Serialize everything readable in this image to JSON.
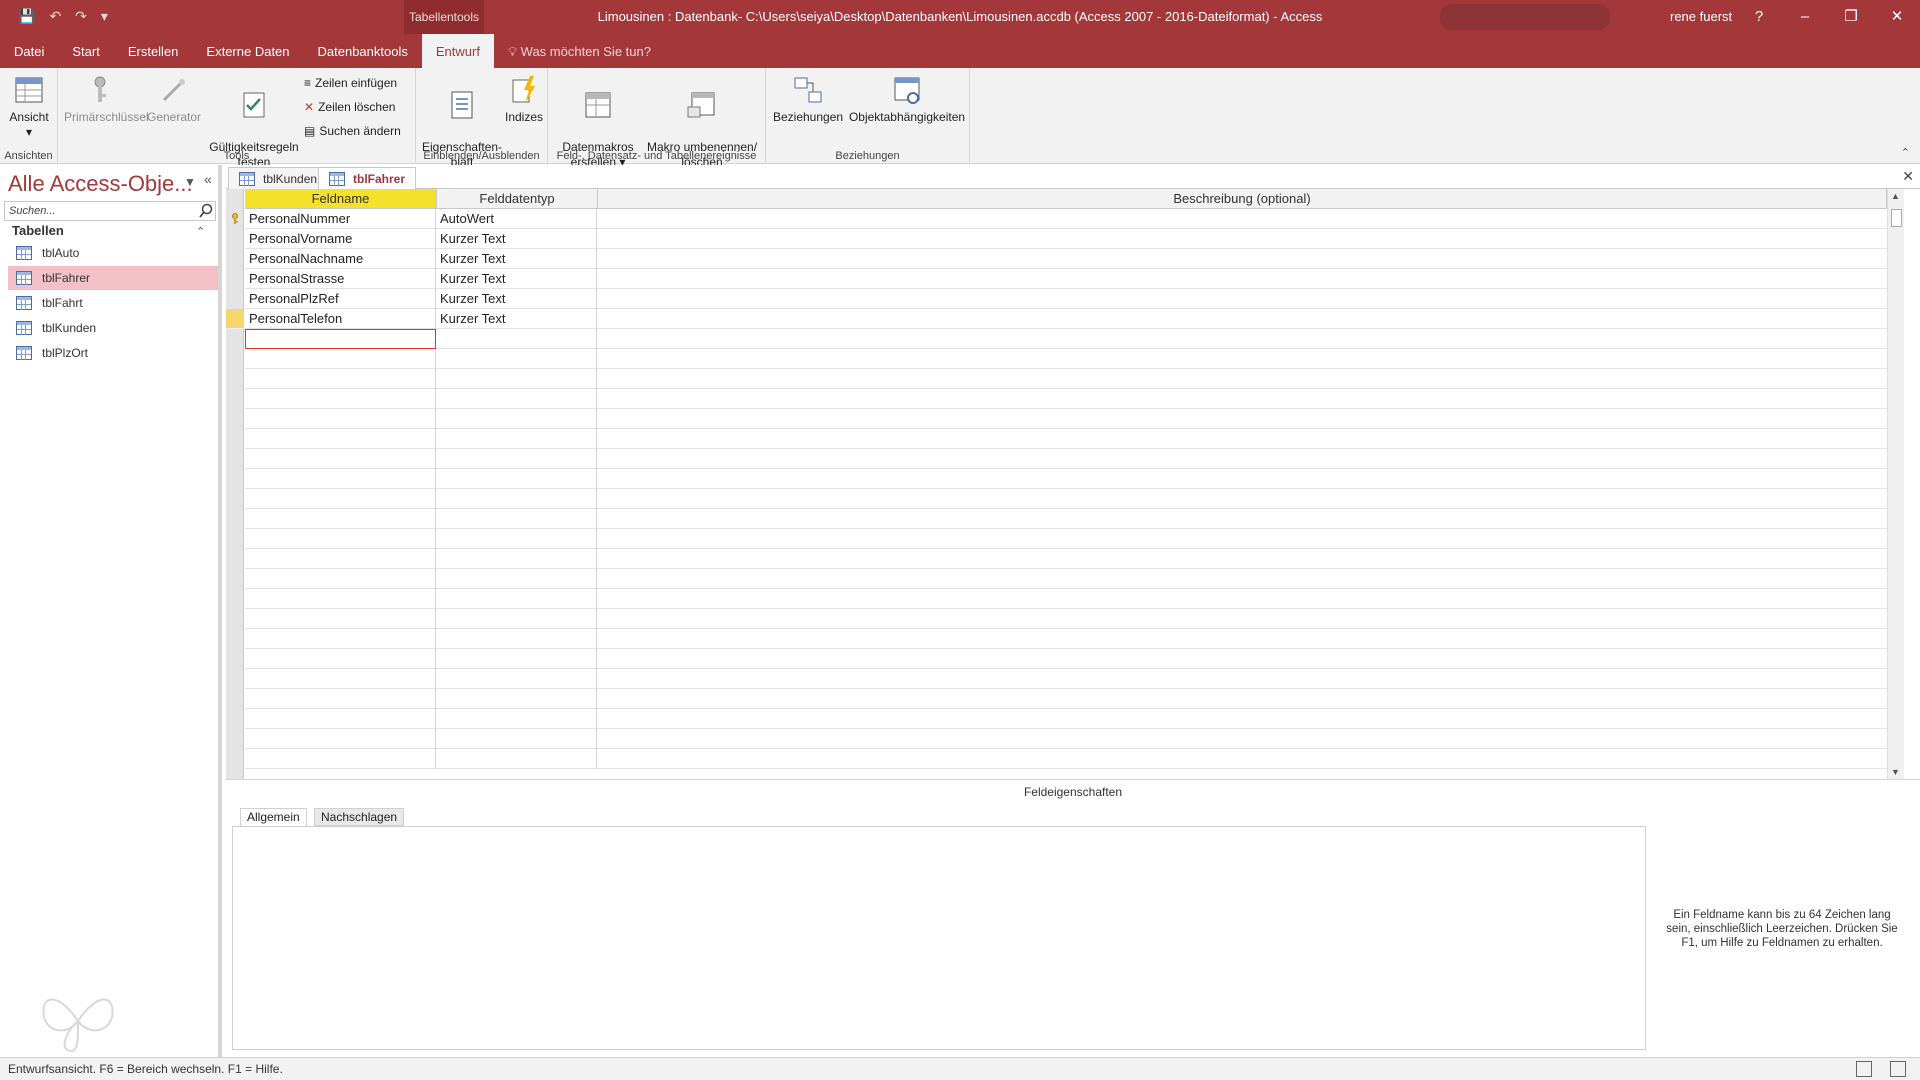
{
  "titlebar": {
    "context_tab": "Tabellentools",
    "title": "Limousinen : Datenbank- C:\\Users\\seiya\\Desktop\\Datenbanken\\Limousinen.accdb (Access 2007 - 2016-Dateiformat)  -  Access",
    "user": "rene fuerst",
    "help": "?",
    "minimize": "–",
    "restore": "❐",
    "close": "✕",
    "qat": {
      "save": "💾",
      "undo": "↶",
      "redo": "↷",
      "customize": "▾"
    }
  },
  "menu": {
    "tabs": [
      "Datei",
      "Start",
      "Erstellen",
      "Externe Daten",
      "Datenbanktools",
      "Entwurf"
    ],
    "tell_me": "Was möchten Sie tun?"
  },
  "ribbon": {
    "groups": {
      "ansichten": {
        "label": "Ansichten",
        "ansicht": "Ansicht"
      },
      "tools": {
        "label": "Tools",
        "primaerschluessel": "Primärschlüssel",
        "generator": "Generator",
        "gueltigkeitsregeln": "Gültigkeitsregeln\ntesten",
        "zeilen_einfuegen": "Zeilen einfügen",
        "zeilen_loeschen": "Zeilen löschen",
        "suchen_aendern": "Suchen ändern"
      },
      "einblenden": {
        "label": "Einblenden/Ausblenden",
        "eigenschaftenblatt": "Eigenschaften-\nblatt",
        "indizes": "Indizes"
      },
      "ereignisse": {
        "label": "Feld-, Datensatz- und Tabellenereignisse",
        "datenmakros": "Datenmakros\nerstellen",
        "makro_umbenennen": "Makro umbenennen/\nlöschen"
      },
      "beziehungen": {
        "label": "Beziehungen",
        "beziehungen": "Beziehungen",
        "objektabhaengigkeiten": "Objektabhängigkeiten"
      }
    }
  },
  "navpane": {
    "title": "Alle Access-Obje...",
    "search_placeholder": "Suchen...",
    "category": "Tabellen",
    "items": [
      "tblAuto",
      "tblFahrer",
      "tblFahrt",
      "tblKunden",
      "tblPlzOrt"
    ],
    "selected_index": 1
  },
  "doctabs": [
    "tblKunden",
    "tblFahrer"
  ],
  "grid": {
    "headers": [
      "Feldname",
      "Felddatentyp",
      "Beschreibung (optional)"
    ],
    "rows": [
      {
        "feldname": "PersonalNummer",
        "datentyp": "AutoWert",
        "beschreibung": "",
        "primary_key": true
      },
      {
        "feldname": "PersonalVorname",
        "datentyp": "Kurzer Text",
        "beschreibung": ""
      },
      {
        "feldname": "PersonalNachname",
        "datentyp": "Kurzer Text",
        "beschreibung": ""
      },
      {
        "feldname": "PersonalStrasse",
        "datentyp": "Kurzer Text",
        "beschreibung": ""
      },
      {
        "feldname": "PersonalPlzRef",
        "datentyp": "Kurzer Text",
        "beschreibung": ""
      },
      {
        "feldname": "PersonalTelefon",
        "datentyp": "Kurzer Text",
        "beschreibung": ""
      },
      {
        "feldname": "",
        "datentyp": "",
        "beschreibung": ""
      }
    ]
  },
  "props": {
    "title": "Feldeigenschaften",
    "tabs": [
      "Allgemein",
      "Nachschlagen"
    ],
    "help_text": "Ein Feldname kann bis zu 64 Zeichen lang sein, einschließlich Leerzeichen. Drücken Sie F1, um Hilfe zu Feldnamen zu erhalten."
  },
  "statusbar": {
    "text": "Entwurfsansicht. F6 = Bereich wechseln. F1 = Hilfe."
  },
  "colors": {
    "accent": "#a4373a",
    "selected_nav": "#f3c0c8",
    "header_highlight": "#f5e12a"
  }
}
